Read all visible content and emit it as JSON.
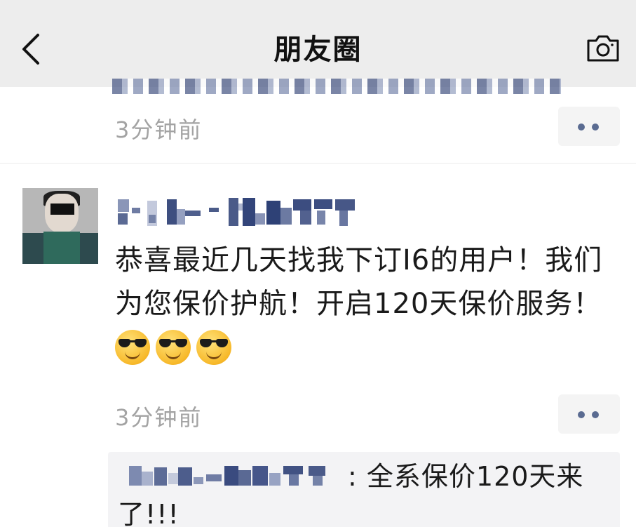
{
  "nav": {
    "title": "朋友圈",
    "back_icon": "back-chevron-icon",
    "camera_icon": "camera-icon"
  },
  "previous_post": {
    "time": "3分钟前",
    "more_icon": "more-dots-icon"
  },
  "post": {
    "text": "恭喜最近几天找我下订I6的用户！我们为您保价护航！开启120天保价服务！",
    "emojis": [
      "sunglasses-emoji",
      "sunglasses-emoji",
      "sunglasses-emoji"
    ],
    "time": "3分钟前",
    "more_icon": "more-dots-icon"
  },
  "comment": {
    "separator": ": ",
    "text": "全系保价120天来了!!!"
  },
  "colors": {
    "nav_bg": "#ededed",
    "link_blue": "#576b95",
    "time_gray": "#a3a3a3",
    "comment_bg": "#f3f3f5"
  }
}
